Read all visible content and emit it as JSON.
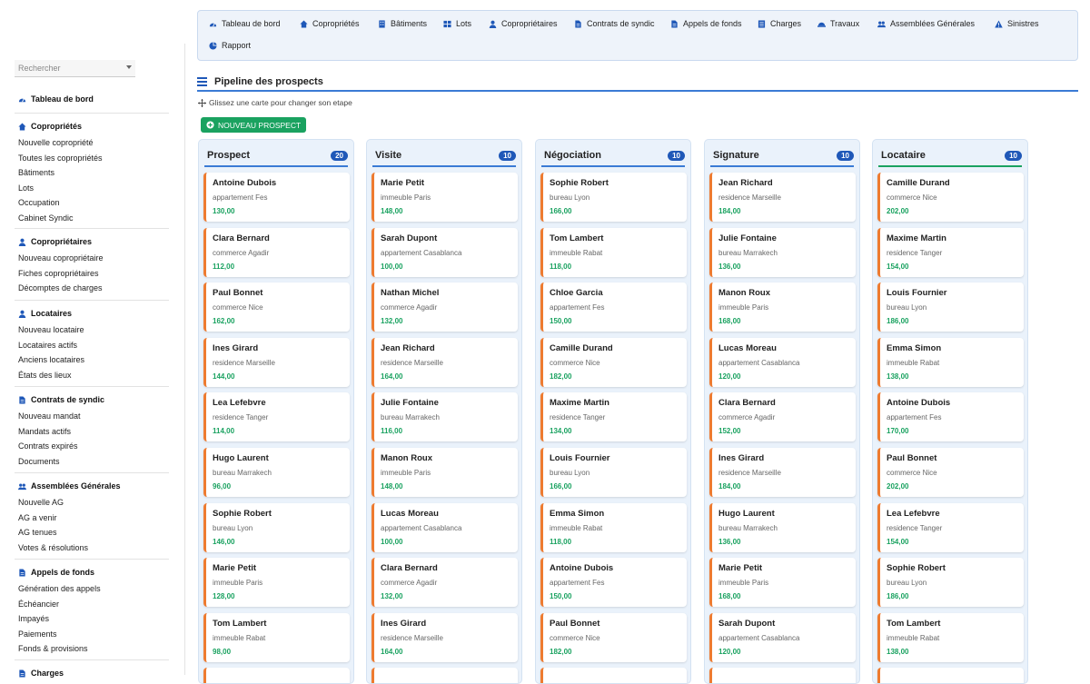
{
  "search": {
    "placeholder": "Rechercher"
  },
  "sidebar": {
    "home": "Tableau de bord",
    "sections": [
      {
        "title": "Copropriétés",
        "icon": "home-icon",
        "items": [
          "Nouvelle copropriété",
          "Toutes les copropriétés",
          "Bâtiments",
          "Lots",
          "Occupation",
          "Cabinet Syndic"
        ]
      },
      {
        "title": "Copropriétaires",
        "icon": "user-icon",
        "items": [
          "Nouveau copropriétaire",
          "Fiches copropriétaires",
          "Décomptes de charges"
        ]
      },
      {
        "title": "Locataires",
        "icon": "user-icon",
        "items": [
          "Nouveau locataire",
          "Locataires actifs",
          "Anciens locataires",
          "États des lieux"
        ]
      },
      {
        "title": "Contrats de syndic",
        "icon": "file-icon",
        "items": [
          "Nouveau mandat",
          "Mandats actifs",
          "Contrats expirés",
          "Documents"
        ]
      },
      {
        "title": "Assemblées Générales",
        "icon": "users-icon",
        "items": [
          "Nouvelle AG",
          "AG a venir",
          "AG tenues",
          "Votes & résolutions"
        ]
      },
      {
        "title": "Appels de fonds",
        "icon": "file-icon",
        "items": [
          "Génération des appels",
          "Échéancier",
          "Impayés",
          "Paiements",
          "Fonds & provisions"
        ]
      },
      {
        "title": "Charges",
        "icon": "file-icon",
        "items": []
      }
    ]
  },
  "topnav": {
    "items": [
      {
        "label": "Tableau de bord",
        "icon": "dashboard-icon"
      },
      {
        "label": "Copropriétés",
        "icon": "home-icon"
      },
      {
        "label": "Bâtiments",
        "icon": "building-icon"
      },
      {
        "label": "Lots",
        "icon": "grid-icon"
      },
      {
        "label": "Copropriétaires",
        "icon": "user-icon"
      },
      {
        "label": "Contrats de syndic",
        "icon": "file-icon"
      },
      {
        "label": "Appels de fonds",
        "icon": "file-icon"
      },
      {
        "label": "Charges",
        "icon": "list-icon"
      },
      {
        "label": "Travaux",
        "icon": "helmet-icon"
      },
      {
        "label": "Assemblées Générales",
        "icon": "users-icon"
      },
      {
        "label": "Sinistres",
        "icon": "warning-icon"
      },
      {
        "label": "Rapport",
        "icon": "pie-icon"
      }
    ]
  },
  "page": {
    "title": "Pipeline des prospects",
    "hint": "Glissez une carte pour changer son etape",
    "new_button": "NOUVEAU PROSPECT"
  },
  "colors": {
    "accent": "#3a7bd5",
    "badge": "#1f58b8",
    "success": "#1aa260",
    "card_border": "#ee7b30"
  },
  "columns": [
    {
      "title": "Prospect",
      "count": "20",
      "cards": [
        {
          "name": "Antoine Dubois",
          "sub": "appartement Fes",
          "amount": "130,00"
        },
        {
          "name": "Clara Bernard",
          "sub": "commerce Agadir",
          "amount": "112,00"
        },
        {
          "name": "Paul Bonnet",
          "sub": "commerce Nice",
          "amount": "162,00"
        },
        {
          "name": "Ines Girard",
          "sub": "residence Marseille",
          "amount": "144,00"
        },
        {
          "name": "Lea Lefebvre",
          "sub": "residence Tanger",
          "amount": "114,00"
        },
        {
          "name": "Hugo Laurent",
          "sub": "bureau Marrakech",
          "amount": "96,00"
        },
        {
          "name": "Sophie Robert",
          "sub": "bureau Lyon",
          "amount": "146,00"
        },
        {
          "name": "Marie Petit",
          "sub": "immeuble Paris",
          "amount": "128,00"
        },
        {
          "name": "Tom Lambert",
          "sub": "immeuble Rabat",
          "amount": "98,00"
        }
      ]
    },
    {
      "title": "Visite",
      "count": "10",
      "cards": [
        {
          "name": "Marie Petit",
          "sub": "immeuble Paris",
          "amount": "148,00"
        },
        {
          "name": "Sarah Dupont",
          "sub": "appartement Casablanca",
          "amount": "100,00"
        },
        {
          "name": "Nathan Michel",
          "sub": "commerce Agadir",
          "amount": "132,00"
        },
        {
          "name": "Jean Richard",
          "sub": "residence Marseille",
          "amount": "164,00"
        },
        {
          "name": "Julie Fontaine",
          "sub": "bureau Marrakech",
          "amount": "116,00"
        },
        {
          "name": "Manon Roux",
          "sub": "immeuble Paris",
          "amount": "148,00"
        },
        {
          "name": "Lucas Moreau",
          "sub": "appartement Casablanca",
          "amount": "100,00"
        },
        {
          "name": "Clara Bernard",
          "sub": "commerce Agadir",
          "amount": "132,00"
        },
        {
          "name": "Ines Girard",
          "sub": "residence Marseille",
          "amount": "164,00"
        }
      ]
    },
    {
      "title": "Négociation",
      "count": "10",
      "cards": [
        {
          "name": "Sophie Robert",
          "sub": "bureau Lyon",
          "amount": "166,00"
        },
        {
          "name": "Tom Lambert",
          "sub": "immeuble Rabat",
          "amount": "118,00"
        },
        {
          "name": "Chloe Garcia",
          "sub": "appartement Fes",
          "amount": "150,00"
        },
        {
          "name": "Camille Durand",
          "sub": "commerce Nice",
          "amount": "182,00"
        },
        {
          "name": "Maxime Martin",
          "sub": "residence Tanger",
          "amount": "134,00"
        },
        {
          "name": "Louis Fournier",
          "sub": "bureau Lyon",
          "amount": "166,00"
        },
        {
          "name": "Emma Simon",
          "sub": "immeuble Rabat",
          "amount": "118,00"
        },
        {
          "name": "Antoine Dubois",
          "sub": "appartement Fes",
          "amount": "150,00"
        },
        {
          "name": "Paul Bonnet",
          "sub": "commerce Nice",
          "amount": "182,00"
        }
      ]
    },
    {
      "title": "Signature",
      "count": "10",
      "cards": [
        {
          "name": "Jean Richard",
          "sub": "residence Marseille",
          "amount": "184,00"
        },
        {
          "name": "Julie Fontaine",
          "sub": "bureau Marrakech",
          "amount": "136,00"
        },
        {
          "name": "Manon Roux",
          "sub": "immeuble Paris",
          "amount": "168,00"
        },
        {
          "name": "Lucas Moreau",
          "sub": "appartement Casablanca",
          "amount": "120,00"
        },
        {
          "name": "Clara Bernard",
          "sub": "commerce Agadir",
          "amount": "152,00"
        },
        {
          "name": "Ines Girard",
          "sub": "residence Marseille",
          "amount": "184,00"
        },
        {
          "name": "Hugo Laurent",
          "sub": "bureau Marrakech",
          "amount": "136,00"
        },
        {
          "name": "Marie Petit",
          "sub": "immeuble Paris",
          "amount": "168,00"
        },
        {
          "name": "Sarah Dupont",
          "sub": "appartement Casablanca",
          "amount": "120,00"
        }
      ]
    },
    {
      "title": "Locataire",
      "count": "10",
      "cards": [
        {
          "name": "Camille Durand",
          "sub": "commerce Nice",
          "amount": "202,00"
        },
        {
          "name": "Maxime Martin",
          "sub": "residence Tanger",
          "amount": "154,00"
        },
        {
          "name": "Louis Fournier",
          "sub": "bureau Lyon",
          "amount": "186,00"
        },
        {
          "name": "Emma Simon",
          "sub": "immeuble Rabat",
          "amount": "138,00"
        },
        {
          "name": "Antoine Dubois",
          "sub": "appartement Fes",
          "amount": "170,00"
        },
        {
          "name": "Paul Bonnet",
          "sub": "commerce Nice",
          "amount": "202,00"
        },
        {
          "name": "Lea Lefebvre",
          "sub": "residence Tanger",
          "amount": "154,00"
        },
        {
          "name": "Sophie Robert",
          "sub": "bureau Lyon",
          "amount": "186,00"
        },
        {
          "name": "Tom Lambert",
          "sub": "immeuble Rabat",
          "amount": "138,00"
        }
      ]
    }
  ]
}
